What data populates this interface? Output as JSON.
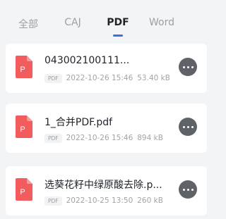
{
  "tabs": [
    {
      "label": "全部",
      "active": false
    },
    {
      "label": "CAJ",
      "active": false
    },
    {
      "label": "PDF",
      "active": true
    },
    {
      "label": "Word",
      "active": false
    }
  ],
  "files": [
    {
      "icon_letter": "P",
      "name": "043002100111...",
      "type_badge": "PDF",
      "date": "2022-10-26 15:46",
      "size": "53.40 kB"
    },
    {
      "icon_letter": "P",
      "name": "1_合并PDF.pdf",
      "type_badge": "PDF",
      "date": "2022-10-26 15:46",
      "size": "894 kB"
    },
    {
      "icon_letter": "P",
      "name": "选葵花籽中绿原酸去除.p...",
      "type_badge": "PDF",
      "date": "2022-10-25 13:50",
      "size": "260 kB"
    }
  ],
  "colors": {
    "accent": "#3b6ee6",
    "file_icon": "#f25c5c",
    "background": "#f3f4f6",
    "more_button": "#5f6368"
  }
}
